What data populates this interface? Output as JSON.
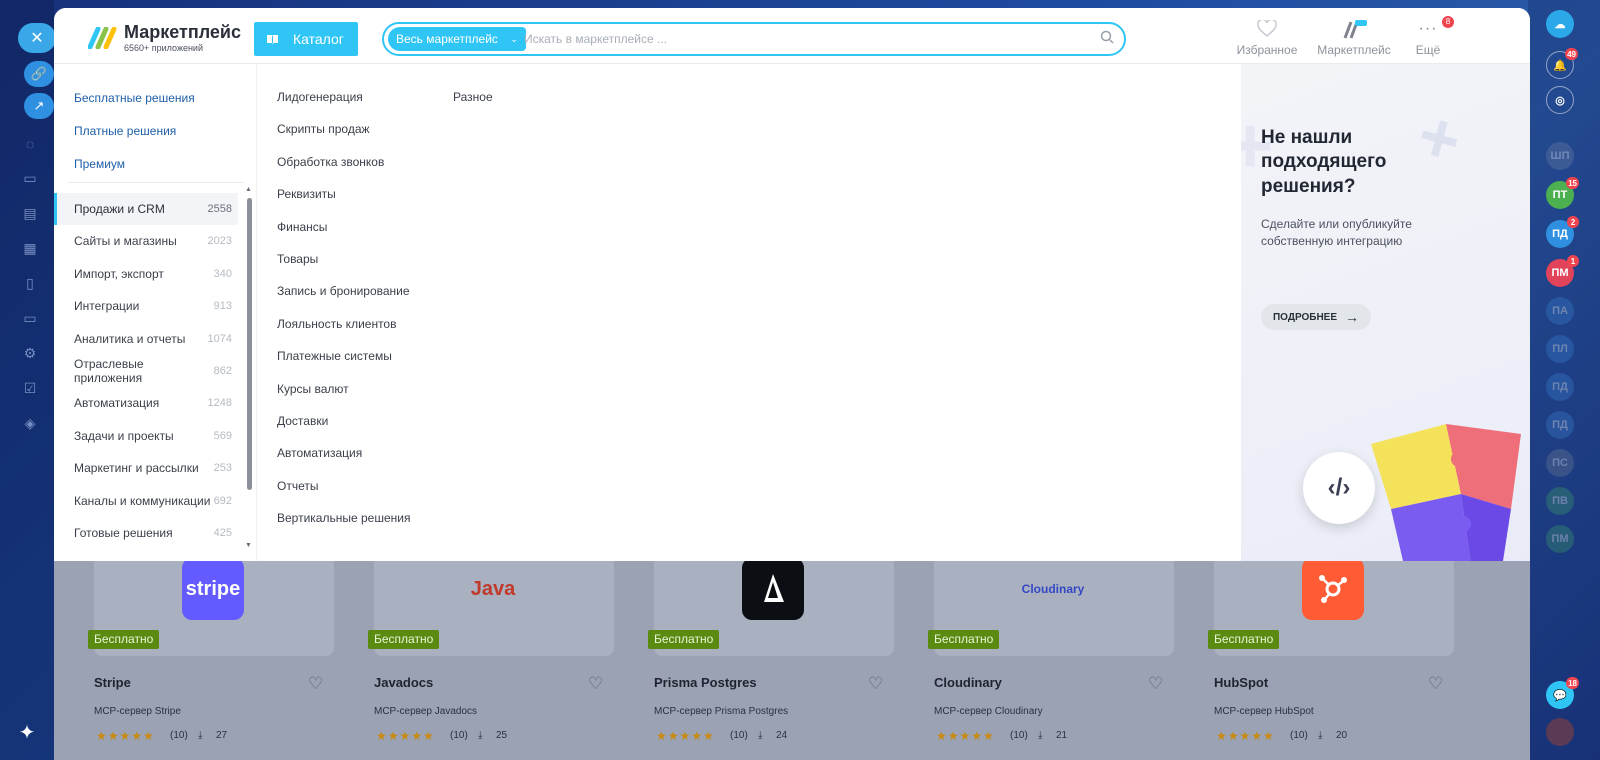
{
  "header": {
    "logo_title": "Маркетплейс",
    "logo_subtitle": "6560+ приложений",
    "catalog_label": "Каталог",
    "search_scope": "Весь маркетплейс",
    "search_placeholder": "Искать в маркетплейсе ...",
    "favorites_label": "Избранное",
    "marketplace_label": "Маркетплейс",
    "more_label": "Ещё",
    "more_badge": "8"
  },
  "sidebar": {
    "quick_links": [
      "Бесплатные решения",
      "Платные решения",
      "Премиум"
    ],
    "categories": [
      {
        "label": "Продажи и CRM",
        "count": "2558",
        "active": true
      },
      {
        "label": "Сайты и магазины",
        "count": "2023"
      },
      {
        "label": "Импорт, экспорт",
        "count": "340"
      },
      {
        "label": "Интеграции",
        "count": "913"
      },
      {
        "label": "Аналитика и отчеты",
        "count": "1074"
      },
      {
        "label": "Отраслевые приложения",
        "count": "862"
      },
      {
        "label": "Автоматизация",
        "count": "1248"
      },
      {
        "label": "Задачи и проекты",
        "count": "569"
      },
      {
        "label": "Маркетинг и рассылки",
        "count": "253"
      },
      {
        "label": "Каналы и коммуникации",
        "count": "692"
      },
      {
        "label": "Готовые решения",
        "count": "425"
      }
    ]
  },
  "subcategories": {
    "column1": [
      "Лидогенерация",
      "Скрипты продаж",
      "Обработка звонков",
      "Реквизиты",
      "Финансы",
      "Товары",
      "Запись и бронирование",
      "Лояльность клиентов",
      "Платежные системы",
      "Курсы валют",
      "Доставки",
      "Автоматизация",
      "Отчеты",
      "Вертикальные решения"
    ],
    "column2": [
      "Разное"
    ]
  },
  "promo": {
    "title": "Не нашли подходящего решения?",
    "text": "Сделайте или опубликуйте собственную интеграцию",
    "button": "ПОДРОБНЕЕ"
  },
  "cards": [
    {
      "title": "Stripe",
      "subtitle": "MCP-сервер Stripe",
      "badge": "Бесплатно",
      "rating": "(10)",
      "installs": "27",
      "logo_text": "stripe",
      "logo_color": "#635bff"
    },
    {
      "title": "Javadocs",
      "subtitle": "MCP-сервер Javadocs",
      "badge": "Бесплатно",
      "rating": "(10)",
      "installs": "25",
      "logo_text": "Java",
      "logo_color": "#c0392b"
    },
    {
      "title": "Prisma Postgres",
      "subtitle": "MCP-сервер Prisma Postgres",
      "badge": "Бесплатно",
      "rating": "(10)",
      "installs": "24",
      "logo_text": "",
      "logo_color": "#0b0f14"
    },
    {
      "title": "Cloudinary",
      "subtitle": "MCP-сервер Cloudinary",
      "badge": "Бесплатно",
      "rating": "(10)",
      "installs": "21",
      "logo_text": "Cloudinary",
      "logo_color": "#3448c5"
    },
    {
      "title": "HubSpot",
      "subtitle": "MCP-сервер HubSpot",
      "badge": "Бесплатно",
      "rating": "(10)",
      "installs": "20",
      "logo_text": "",
      "logo_color": "#ff5c35"
    }
  ],
  "right_rail": {
    "notifications_badge": "49",
    "avatars": [
      {
        "initials": "ШП",
        "color": "#6e7fa8",
        "badge": ""
      },
      {
        "initials": "ПТ",
        "color": "#4caf50",
        "badge": "15"
      },
      {
        "initials": "ПД",
        "color": "#2f8fe0",
        "badge": "2"
      },
      {
        "initials": "ПМ",
        "color": "#e0435a",
        "badge": "1"
      },
      {
        "initials": "ПА",
        "color": "#3b7fd0",
        "badge": ""
      },
      {
        "initials": "ПЛ",
        "color": "#3b7fd0",
        "badge": ""
      },
      {
        "initials": "ПД",
        "color": "#3b7fd0",
        "badge": ""
      },
      {
        "initials": "ПД",
        "color": "#3b7fd0",
        "badge": ""
      },
      {
        "initials": "ПС",
        "color": "#6e7f95",
        "badge": ""
      },
      {
        "initials": "ПВ",
        "color": "#3e9e6a",
        "badge": ""
      },
      {
        "initials": "ПМ",
        "color": "#3e9e6a",
        "badge": ""
      }
    ],
    "chat_badge": "18"
  },
  "colors": {
    "accent": "#2fc6f6",
    "link": "#1f5fa8",
    "free_badge": "#5a8a10"
  }
}
